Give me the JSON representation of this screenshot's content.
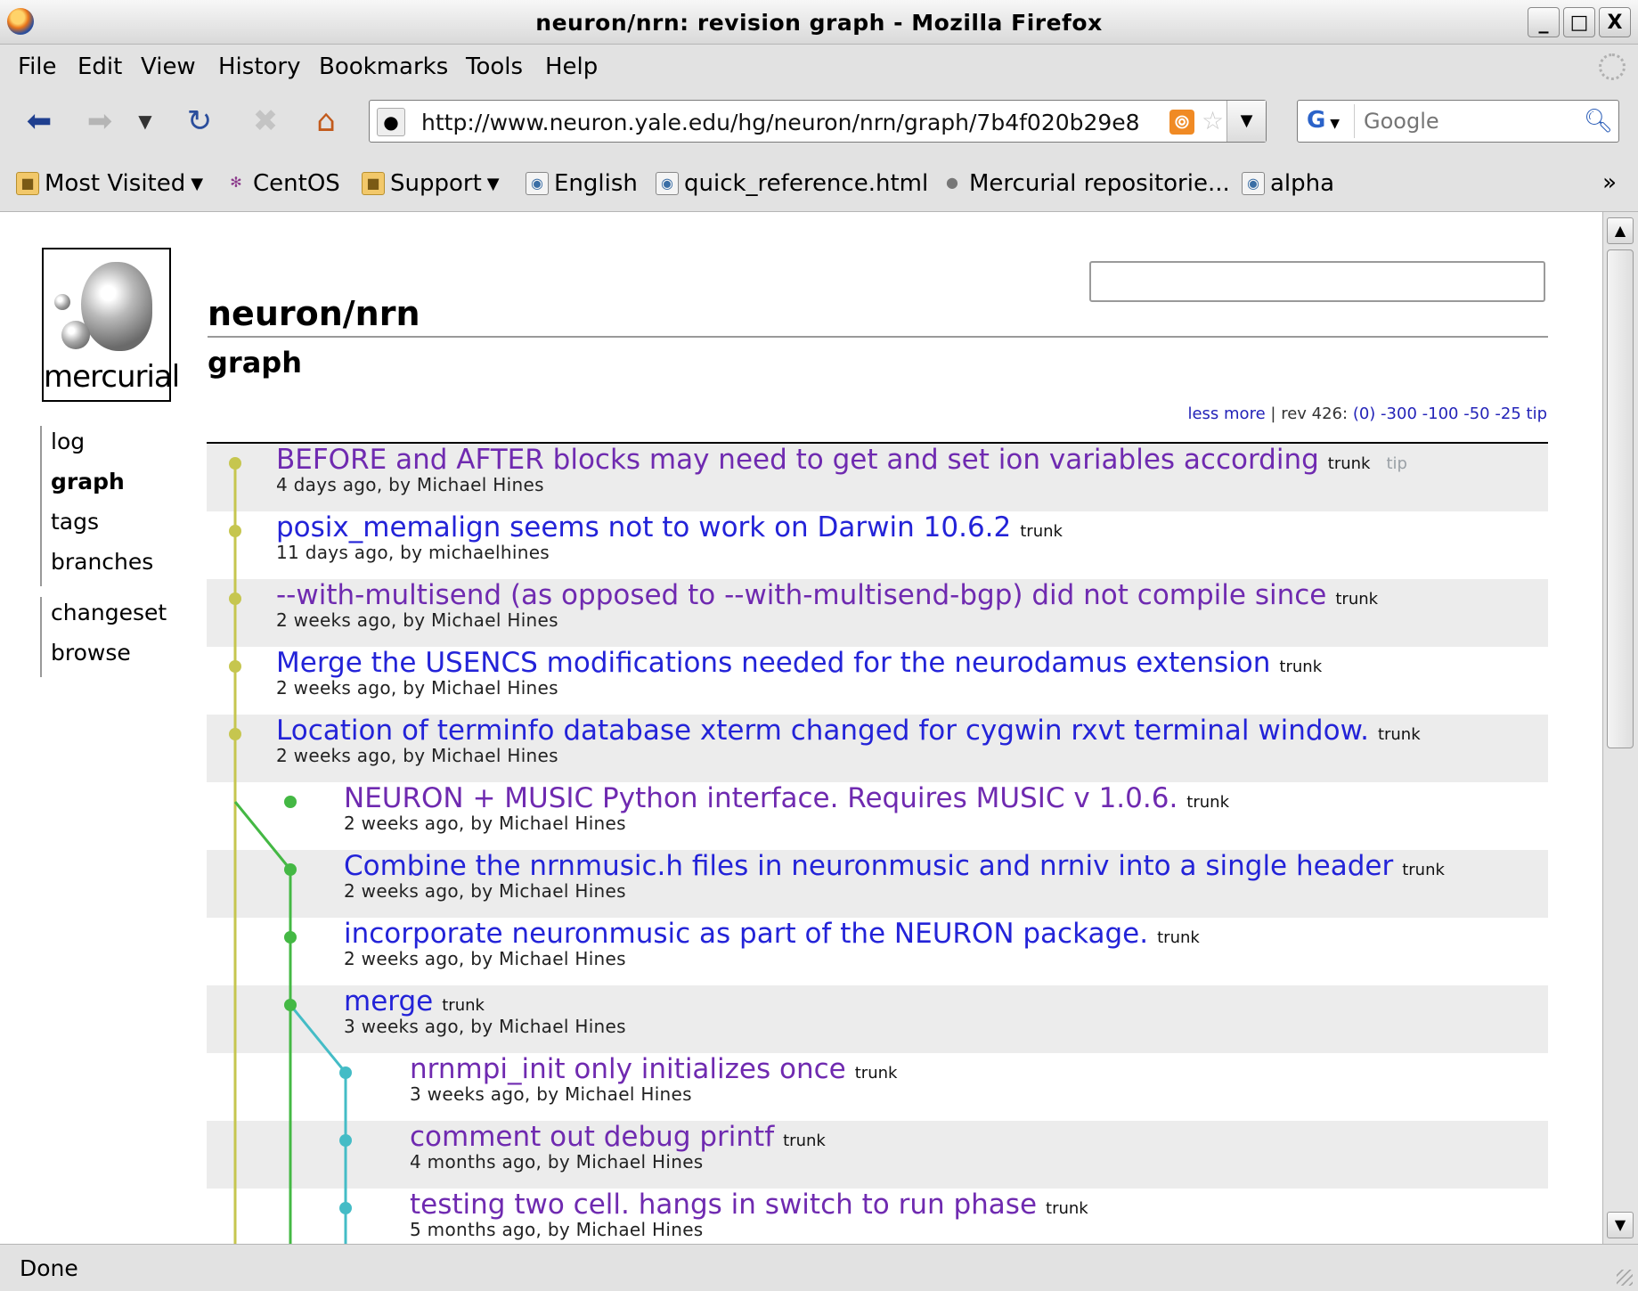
{
  "window": {
    "title": "neuron/nrn: revision graph - Mozilla Firefox",
    "minimize": "_",
    "maximize": "□",
    "close": "X"
  },
  "menu": {
    "file": "File",
    "edit": "Edit",
    "view": "View",
    "history": "History",
    "bookmarks": "Bookmarks",
    "tools": "Tools",
    "help": "Help"
  },
  "nav": {
    "url": "http://www.neuron.yale.edu/hg/neuron/nrn/graph/7b4f020b29e8",
    "search_placeholder": "Google",
    "search_engine": "G"
  },
  "bookmarks_bar": {
    "items": [
      "Most Visited",
      "CentOS",
      "Support",
      "English",
      "quick_reference.html",
      "Mercurial repositorie...",
      "alpha"
    ],
    "more": "»"
  },
  "page": {
    "logo_text": "mercurial",
    "repo": "neuron/nrn",
    "subtitle": "graph",
    "menu_primary": [
      "log",
      "graph",
      "tags",
      "branches"
    ],
    "menu_secondary": [
      "changeset",
      "browse"
    ],
    "navigate": {
      "less": "less",
      "more": "more",
      "divider1": "|",
      "rev_label": "rev 426:",
      "links": [
        "(0)",
        "-300",
        "-100",
        "-50",
        "-25",
        "tip"
      ]
    }
  },
  "changesets": [
    {
      "desc": "BEFORE and AFTER blocks may need to get and set ion variables according",
      "branch": "trunk",
      "tag": "tip",
      "meta": "4 days ago, by Michael Hines",
      "visited": true
    },
    {
      "desc": "posix_memalign seems not to work on Darwin 10.6.2",
      "branch": "trunk",
      "tag": "",
      "meta": "11 days ago, by michaelhines",
      "visited": false
    },
    {
      "desc": "--with-multisend (as opposed to --with-multisend-bgp) did not compile since",
      "branch": "trunk",
      "tag": "",
      "meta": "2 weeks ago, by Michael Hines",
      "visited": true
    },
    {
      "desc": "Merge the USENCS modifications needed for the neurodamus extension",
      "branch": "trunk",
      "tag": "",
      "meta": "2 weeks ago, by Michael Hines",
      "visited": false
    },
    {
      "desc": "Location of terminfo database xterm changed for cygwin rxvt terminal window.",
      "branch": "trunk",
      "tag": "",
      "meta": "2 weeks ago, by Michael Hines",
      "visited": false
    },
    {
      "desc": "NEURON + MUSIC Python interface. Requires MUSIC v 1.0.6.",
      "branch": "trunk",
      "tag": "",
      "meta": "2 weeks ago, by Michael Hines",
      "visited": true
    },
    {
      "desc": "Combine the nrnmusic.h files in neuronmusic and nrniv into a single header",
      "branch": "trunk",
      "tag": "",
      "meta": "2 weeks ago, by Michael Hines",
      "visited": false
    },
    {
      "desc": "incorporate neuronmusic as part of the NEURON package.",
      "branch": "trunk",
      "tag": "",
      "meta": "2 weeks ago, by Michael Hines",
      "visited": false
    },
    {
      "desc": "merge",
      "branch": "trunk",
      "tag": "",
      "meta": "3 weeks ago, by Michael Hines",
      "visited": false
    },
    {
      "desc": "nrnmpi_init only initializes once",
      "branch": "trunk",
      "tag": "",
      "meta": "3 weeks ago, by Michael Hines",
      "visited": true
    },
    {
      "desc": "comment out debug printf",
      "branch": "trunk",
      "tag": "",
      "meta": "4 months ago, by Michael Hines",
      "visited": true
    },
    {
      "desc": "testing two cell. hangs in switch to run phase",
      "branch": "trunk",
      "tag": "",
      "meta": "5 months ago, by Michael Hines",
      "visited": true
    }
  ],
  "graph_colors": [
    "#c6c64f",
    "#44b844",
    "#44bcc6"
  ],
  "status": {
    "text": "Done"
  }
}
